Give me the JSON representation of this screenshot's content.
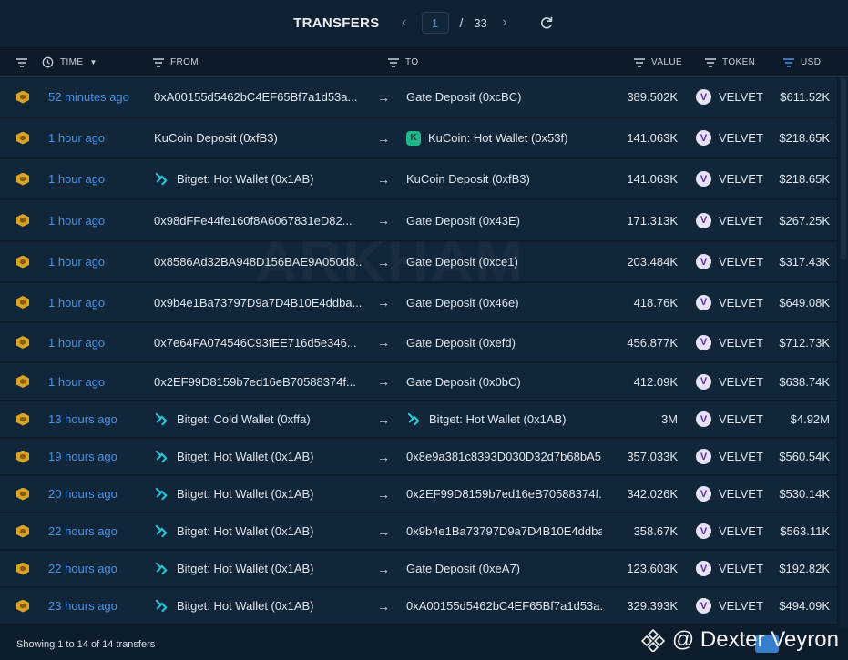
{
  "header": {
    "title": "TRANSFERS",
    "page": "1",
    "separator": "/",
    "total_pages": "33"
  },
  "columns": {
    "time": "TIME",
    "from": "FROM",
    "to": "TO",
    "value": "VALUE",
    "token": "TOKEN",
    "usd": "USD"
  },
  "rows": [
    {
      "time": "52 minutes ago",
      "from": "0xA00155d5462bC4EF65Bf7a1d53a...",
      "from_icon": "",
      "to": "Gate Deposit (0xcBC)",
      "to_icon": "",
      "value": "389.502K",
      "token": "VELVET",
      "usd": "$611.52K"
    },
    {
      "time": "1 hour ago",
      "from": "KuCoin Deposit (0xfB3)",
      "from_icon": "",
      "to": "KuCoin: Hot Wallet (0x53f)",
      "to_icon": "kucoin-icon",
      "value": "141.063K",
      "token": "VELVET",
      "usd": "$218.65K"
    },
    {
      "time": "1 hour ago",
      "from": "Bitget: Hot Wallet (0x1AB)",
      "from_icon": "bitget-icon",
      "to": "KuCoin Deposit (0xfB3)",
      "to_icon": "",
      "value": "141.063K",
      "token": "VELVET",
      "usd": "$218.65K"
    },
    {
      "time": "1 hour ago",
      "from": "0x98dFFe44fe160f8A6067831eD82...",
      "from_icon": "",
      "to": "Gate Deposit (0x43E)",
      "to_icon": "",
      "value": "171.313K",
      "token": "VELVET",
      "usd": "$267.25K"
    },
    {
      "time": "1 hour ago",
      "from": "0x8586Ad32BA948D156BAE9A050d8...",
      "from_icon": "",
      "to": "Gate Deposit (0xce1)",
      "to_icon": "",
      "value": "203.484K",
      "token": "VELVET",
      "usd": "$317.43K"
    },
    {
      "time": "1 hour ago",
      "from": "0x9b4e1Ba73797D9a7D4B10E4ddba...",
      "from_icon": "",
      "to": "Gate Deposit (0x46e)",
      "to_icon": "",
      "value": "418.76K",
      "token": "VELVET",
      "usd": "$649.08K"
    },
    {
      "time": "1 hour ago",
      "from": "0x7e64FA074546C93fEE716d5e346...",
      "from_icon": "",
      "to": "Gate Deposit (0xefd)",
      "to_icon": "",
      "value": "456.877K",
      "token": "VELVET",
      "usd": "$712.73K"
    },
    {
      "time": "1 hour ago",
      "from": "0x2EF99D8159b7ed16eB70588374f...",
      "from_icon": "",
      "to": "Gate Deposit (0x0bC)",
      "to_icon": "",
      "value": "412.09K",
      "token": "VELVET",
      "usd": "$638.74K"
    },
    {
      "time": "13 hours ago",
      "from": "Bitget: Cold Wallet (0xffa)",
      "from_icon": "bitget-icon",
      "to": "Bitget: Hot Wallet (0x1AB)",
      "to_icon": "bitget-icon",
      "value": "3M",
      "token": "VELVET",
      "usd": "$4.92M"
    },
    {
      "time": "19 hours ago",
      "from": "Bitget: Hot Wallet (0x1AB)",
      "from_icon": "bitget-icon",
      "to": "0x8e9a381c8393D030D32d7b68bA5...",
      "to_icon": "",
      "value": "357.033K",
      "token": "VELVET",
      "usd": "$560.54K"
    },
    {
      "time": "20 hours ago",
      "from": "Bitget: Hot Wallet (0x1AB)",
      "from_icon": "bitget-icon",
      "to": "0x2EF99D8159b7ed16eB70588374f...",
      "to_icon": "",
      "value": "342.026K",
      "token": "VELVET",
      "usd": "$530.14K"
    },
    {
      "time": "22 hours ago",
      "from": "Bitget: Hot Wallet (0x1AB)",
      "from_icon": "bitget-icon",
      "to": "0x9b4e1Ba73797D9a7D4B10E4ddba...",
      "to_icon": "",
      "value": "358.67K",
      "token": "VELVET",
      "usd": "$563.11K"
    },
    {
      "time": "22 hours ago",
      "from": "Bitget: Hot Wallet (0x1AB)",
      "from_icon": "bitget-icon",
      "to": "Gate Deposit (0xeA7)",
      "to_icon": "",
      "value": "123.603K",
      "token": "VELVET",
      "usd": "$192.82K"
    },
    {
      "time": "23 hours ago",
      "from": "Bitget: Hot Wallet (0x1AB)",
      "from_icon": "bitget-icon",
      "to": "0xA00155d5462bC4EF65Bf7a1d53a...",
      "to_icon": "",
      "value": "329.393K",
      "token": "VELVET",
      "usd": "$494.09K"
    }
  ],
  "footer": {
    "summary": "Showing 1 to 14 of 14 transfers"
  },
  "watermark": "ARKHAM",
  "credit": "@ Dexter Veyron",
  "colors": {
    "background": "#0d1d2c",
    "row": "#12263a",
    "accent": "#4a93e6",
    "chain_icon": "#d8a427",
    "token_badge": "#5a2ea6",
    "bitget": "#29c4d8",
    "kucoin": "#1fb789"
  }
}
